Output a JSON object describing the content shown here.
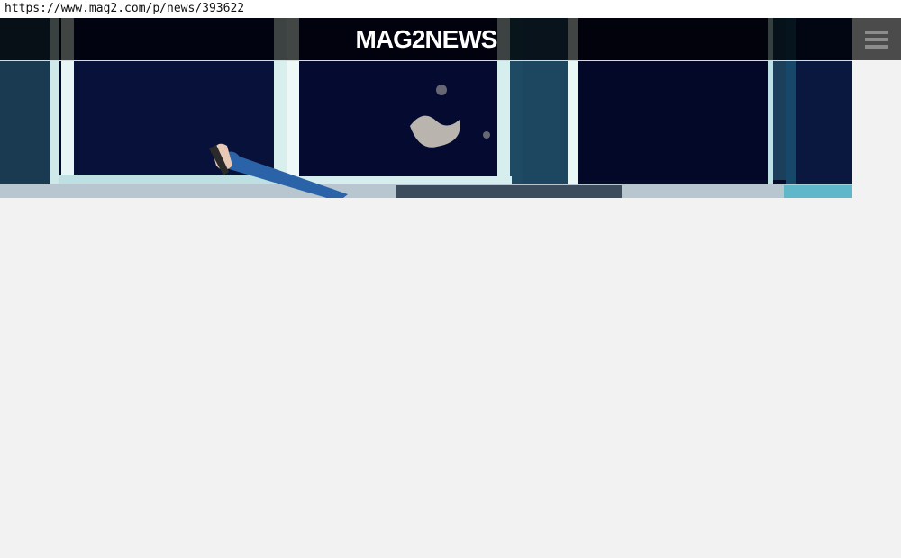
{
  "browser": {
    "url": "https://www.mag2.com/p/news/393622"
  },
  "header": {
    "logo_text": "MAG2NEWS",
    "menu_icon": "hamburger-menu-icon"
  },
  "hero": {
    "image_subject": "person-lying-on-ledge-photo"
  },
  "colors": {
    "header_bg": "#000000",
    "menu_bg": "#4b4b4b",
    "page_bg": "#f2f2f2"
  }
}
